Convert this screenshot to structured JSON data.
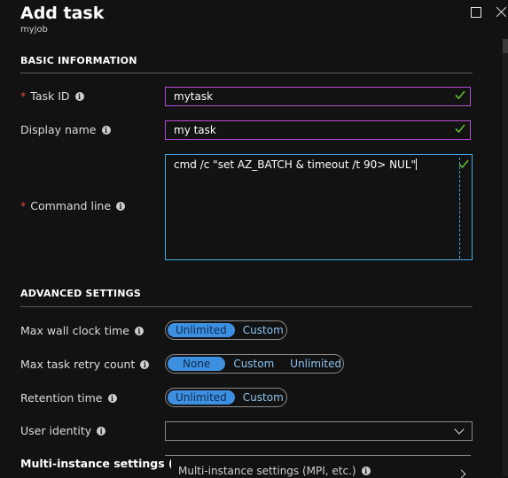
{
  "header": {
    "title": "Add task",
    "subtitle": "myjob",
    "maximize_icon": "maximize-icon",
    "close_icon": "close-icon"
  },
  "basic": {
    "section_title": "BASIC INFORMATION",
    "task_id": {
      "label": "Task ID",
      "required": "*",
      "value": "mytask"
    },
    "display_name": {
      "label": "Display name",
      "value": "my task"
    },
    "command_line": {
      "label": "Command line",
      "required": "*",
      "value": "cmd /c \"set AZ_BATCH & timeout /t 90> NUL\""
    }
  },
  "advanced": {
    "section_title": "ADVANCED SETTINGS",
    "max_wall_clock": {
      "label": "Max wall clock time",
      "options": [
        "Unlimited",
        "Custom"
      ],
      "selected": "Unlimited"
    },
    "max_retry": {
      "label": "Max task retry count",
      "options": [
        "None",
        "Custom",
        "Unlimited"
      ],
      "selected": "None"
    },
    "retention": {
      "label": "Retention time",
      "options": [
        "Unlimited",
        "Custom"
      ],
      "selected": "Unlimited"
    },
    "user_identity": {
      "label": "User identity",
      "value": ""
    },
    "multi_instance": {
      "label": "Multi-instance settings (MPI, etc.)",
      "field_text": "Multi-instance settings (MPI, etc.)"
    }
  },
  "colors": {
    "accent": "#3d8fe0",
    "valid_border": "#b44dd1",
    "focus_border": "#47a7e6",
    "check": "#5fb832",
    "required": "#e0453b"
  }
}
